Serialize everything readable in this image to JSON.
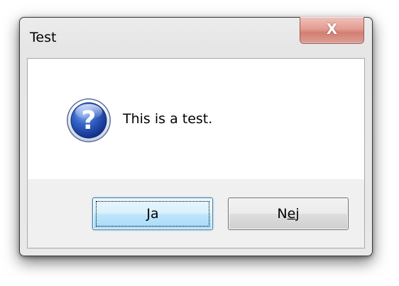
{
  "window": {
    "title": "Test",
    "close_glyph": "X"
  },
  "message": {
    "icon": "question-icon",
    "text": "This is a test."
  },
  "buttons": {
    "yes": {
      "mnemonic": "J",
      "rest": "a",
      "default": true
    },
    "no": {
      "before": "N",
      "mnemonic": "e",
      "after": "j",
      "default": false
    }
  },
  "colors": {
    "icon_blue": "#1f4fb8",
    "default_button_border": "#3c7fb1",
    "close_button": "#d27e73"
  }
}
